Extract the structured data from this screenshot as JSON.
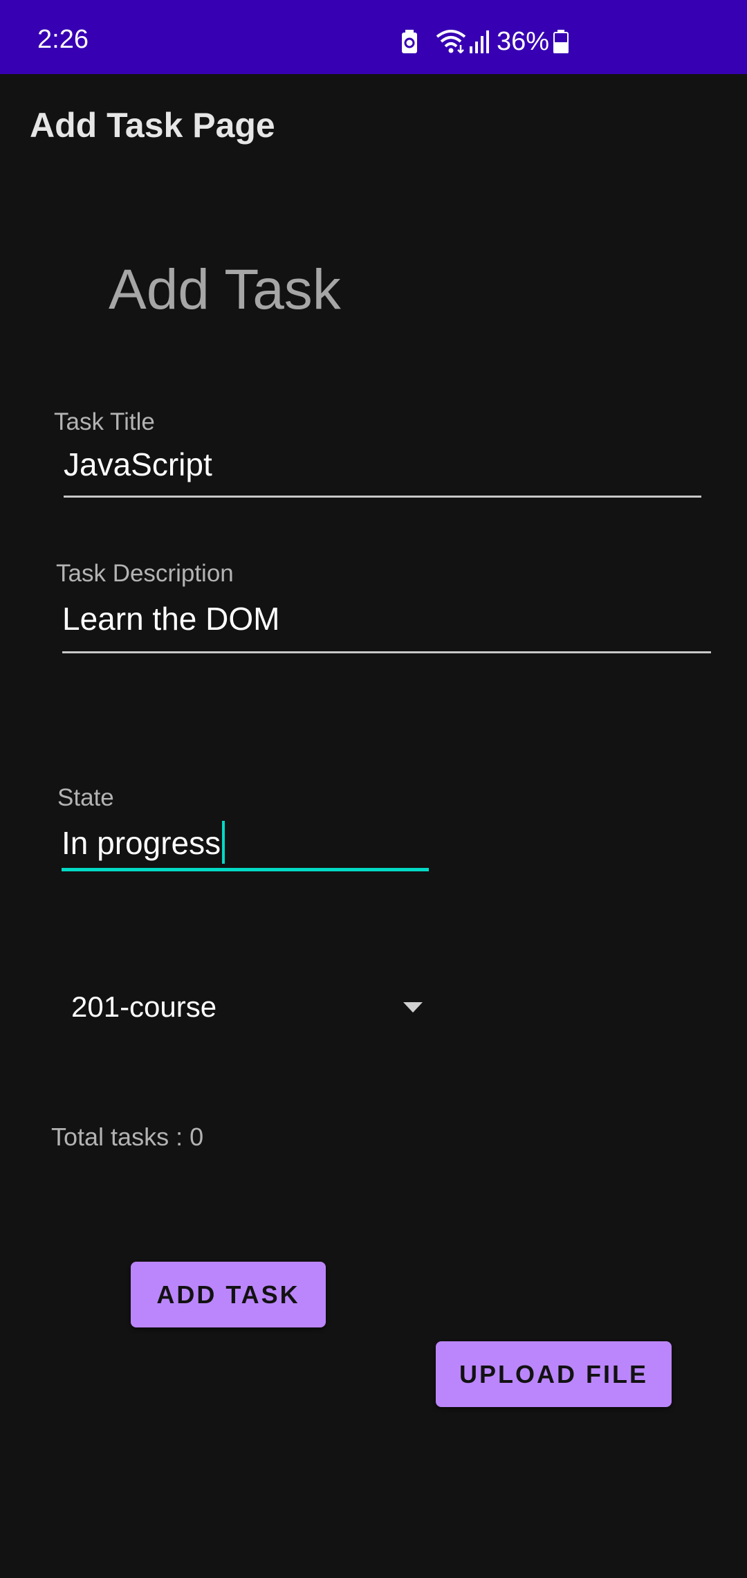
{
  "status_bar": {
    "time": "2:26",
    "battery_percent": "36%",
    "icons": [
      "battery-saver-icon",
      "wifi-icon",
      "signal-icon",
      "battery-icon"
    ],
    "background_color": "#3700B3"
  },
  "app_bar": {
    "title": "Add Task Page"
  },
  "form": {
    "heading": "Add Task",
    "title_field": {
      "label": "Task Title",
      "value": "JavaScript"
    },
    "description_field": {
      "label": "Task Description",
      "value": "Learn the DOM"
    },
    "state_field": {
      "label": "State",
      "value": "In progress",
      "focused": true
    },
    "team_spinner": {
      "selected": "201-course"
    },
    "total_tasks": "Total tasks : 0",
    "add_button_label": "ADD TASK",
    "upload_button_label": "UPLOAD FILE"
  },
  "colors": {
    "background": "#121212",
    "primary": "#BB86FC",
    "accent": "#03DAC5",
    "status_bar": "#3700B3"
  }
}
